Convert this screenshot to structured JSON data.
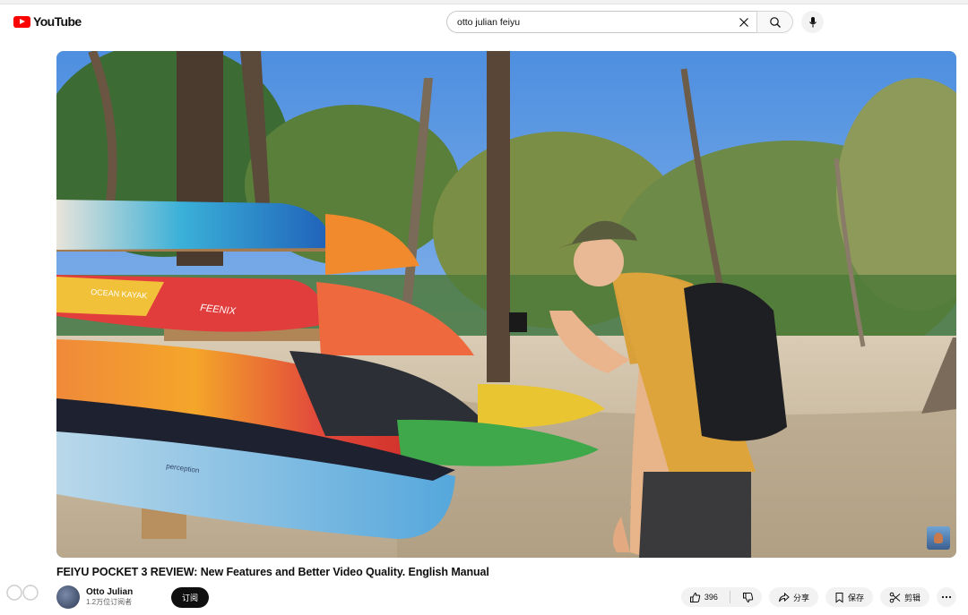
{
  "app": {
    "logo_text": "YouTube",
    "brand_color": "#ff0000"
  },
  "search": {
    "value": "otto julian feiyu",
    "icons": [
      "close-icon",
      "search-icon",
      "mic-icon"
    ]
  },
  "video": {
    "title": "FEIYU POCKET 3 REVIEW: New Features and Better Video Quality. English Manual",
    "kayak_labels": [
      "OCEAN KAYAK",
      "FEENIX",
      "perception"
    ]
  },
  "channel": {
    "name": "Otto Julian",
    "subscribers": "1.2万位订阅者",
    "subscribe_label": "订阅"
  },
  "actions": {
    "like_count": "396",
    "share_label": "分享",
    "save_label": "保存",
    "clip_label": "剪辑",
    "more_icon": "more-horiz-icon"
  }
}
